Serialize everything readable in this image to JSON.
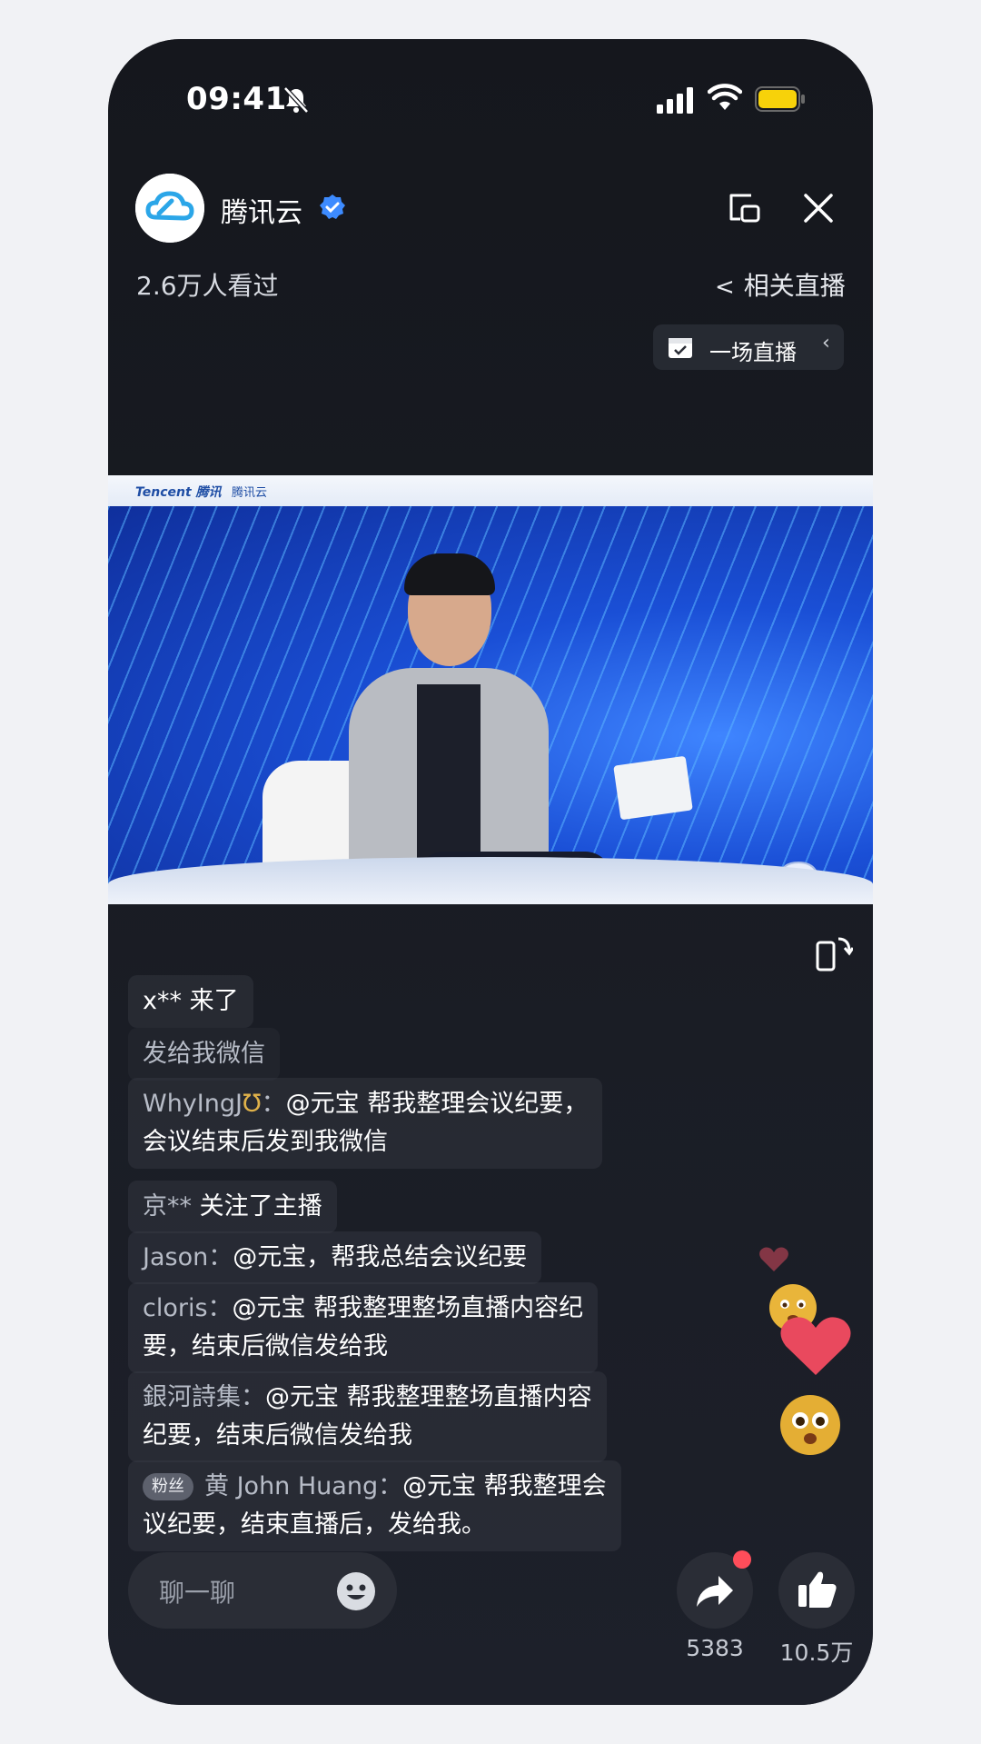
{
  "status_bar": {
    "time": "09:41"
  },
  "header": {
    "channel_name": "腾讯云",
    "viewers": "2.6万人看过",
    "related_live": "相关直播",
    "session_label": "一场直播"
  },
  "video": {
    "brand": "Tencent 腾讯",
    "brand_cloud": "腾讯云"
  },
  "comments": [
    {
      "user": "x**",
      "text": "来了"
    },
    {
      "user": "",
      "text": "发给我微信"
    },
    {
      "user": "WhyIngJ",
      "text": "@元宝 帮我整理会议纪要，",
      "text2": "会议结束后发到我微信"
    },
    {
      "user": "京**",
      "text": "关注了主播"
    },
    {
      "user": "Jason",
      "text": "@元宝，帮我总结会议纪要"
    },
    {
      "user": "cloris",
      "text": "@元宝 帮我整理整场直播内容纪",
      "text2": "要，结束后微信发给我"
    },
    {
      "user": "銀河詩集",
      "text": "@元宝 帮我整理整场直播内容",
      "text2": "纪要，结束后微信发给我"
    },
    {
      "badge": "粉丝",
      "user": "黄 John Huang",
      "text": "@元宝 帮我整理会",
      "text2": "议纪要，结束直播后，发给我。"
    }
  ],
  "bottom_bar": {
    "chat_placeholder": "聊一聊",
    "share_count": "5383",
    "like_count": "10.5万"
  },
  "colors": {
    "background": "#16181f",
    "accent_blue": "#1a4fd6",
    "red_dot": "#ff4d5a",
    "verified": "#3d8bff"
  },
  "icons": [
    "bell-off-icon",
    "signal-icon",
    "wifi-icon",
    "battery-icon",
    "verified-icon",
    "pip-icon",
    "close-icon",
    "chevron-left-icon",
    "calendar-icon",
    "rotate-screen-icon",
    "emoji-icon",
    "share-icon",
    "thumbs-up-icon",
    "heart-icon"
  ]
}
